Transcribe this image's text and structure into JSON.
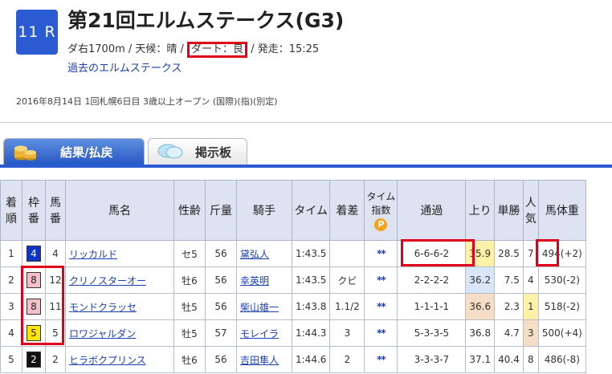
{
  "race": {
    "number": "11 R",
    "title": "第21回エルムステークス(G3)",
    "conditions_prefix": "ダ右1700m / 天候：晴 / ",
    "track": "ダート：良",
    "conditions_suffix": " / 発走：15:25",
    "past_link": "過去のエルムステークス",
    "meta": "2016年8月14日 1回札幌6日目 3歳以上オープン (国際)(指)(別定)"
  },
  "tabs": [
    {
      "label": "結果/払戻",
      "icon": "coin-stack-icon",
      "active": true
    },
    {
      "label": "掲示板",
      "icon": "speech-bubble-icon",
      "active": false
    }
  ],
  "colors": {
    "accent": "#2a5bd3",
    "highlight": "#e0001b",
    "header_bg": "#dde3f1"
  },
  "table": {
    "headers": [
      "着順",
      "枠番",
      "馬番",
      "馬名",
      "性齢",
      "斤量",
      "騎手",
      "タイム",
      "着差",
      "タイム指数",
      "通過",
      "上り",
      "単勝",
      "人気",
      "馬体重"
    ],
    "headers_wrapped": {
      "rank": [
        "着",
        "順"
      ],
      "frame": [
        "枠",
        "番"
      ],
      "horse_no": [
        "馬",
        "番"
      ],
      "pop": [
        "人",
        "気"
      ],
      "time_index": [
        "タイム",
        "指数"
      ]
    },
    "time_index_badge": "P",
    "rows": [
      {
        "rank": "1",
        "frame": "4",
        "frame_color": "#1034c8",
        "frame_text": "#fff",
        "num": "4",
        "horse": "リッカルド",
        "sexage": "セ5",
        "weight": "56",
        "jockey": "黛弘人",
        "time": "1:43.5",
        "margin": "",
        "index": "**",
        "pass": "6-6-6-2",
        "last3f": "35.9",
        "last3f_bg": "#fff2a8",
        "odds": "28.5",
        "pop": "7",
        "pop_bg": "",
        "body": "494(+2)"
      },
      {
        "rank": "2",
        "frame": "8",
        "frame_color": "#f7bfc8",
        "frame_text": "#222",
        "num": "12",
        "horse": "クリノスターオー",
        "sexage": "牡6",
        "weight": "56",
        "jockey": "幸英明",
        "time": "1:43.5",
        "margin": "クビ",
        "index": "**",
        "pass": "2-2-2-2",
        "last3f": "36.2",
        "last3f_bg": "#d8e6f7",
        "odds": "7.5",
        "pop": "4",
        "pop_bg": "",
        "body": "530(-2)"
      },
      {
        "rank": "3",
        "frame": "8",
        "frame_color": "#f7bfc8",
        "frame_text": "#222",
        "num": "11",
        "horse": "モンドクラッセ",
        "sexage": "牡5",
        "weight": "56",
        "jockey": "柴山雄一",
        "time": "1:43.8",
        "margin": "1.1/2",
        "index": "**",
        "pass": "1-1-1-1",
        "last3f": "36.6",
        "last3f_bg": "#f6ddc5",
        "odds": "2.3",
        "pop": "1",
        "pop_bg": "#fff2a8",
        "body": "518(-2)"
      },
      {
        "rank": "4",
        "frame": "5",
        "frame_color": "#ffe600",
        "frame_text": "#222",
        "num": "5",
        "horse": "ロワジャルダン",
        "sexage": "牡5",
        "weight": "57",
        "jockey": "モレイラ",
        "time": "1:44.3",
        "margin": "3",
        "index": "**",
        "pass": "5-3-3-5",
        "last3f": "36.8",
        "last3f_bg": "",
        "odds": "4.7",
        "pop": "3",
        "pop_bg": "#f6ddc5",
        "body": "500(+4)"
      },
      {
        "rank": "5",
        "frame": "2",
        "frame_color": "#111",
        "frame_text": "#fff",
        "num": "2",
        "horse": "ヒラボクプリンス",
        "sexage": "牡6",
        "weight": "56",
        "jockey": "吉田隼人",
        "time": "1:44.6",
        "margin": "2",
        "index": "**",
        "pass": "3-3-3-7",
        "last3f": "37.1",
        "last3f_bg": "",
        "odds": "40.4",
        "pop": "8",
        "pop_bg": "",
        "body": "486(-8)"
      }
    ]
  }
}
